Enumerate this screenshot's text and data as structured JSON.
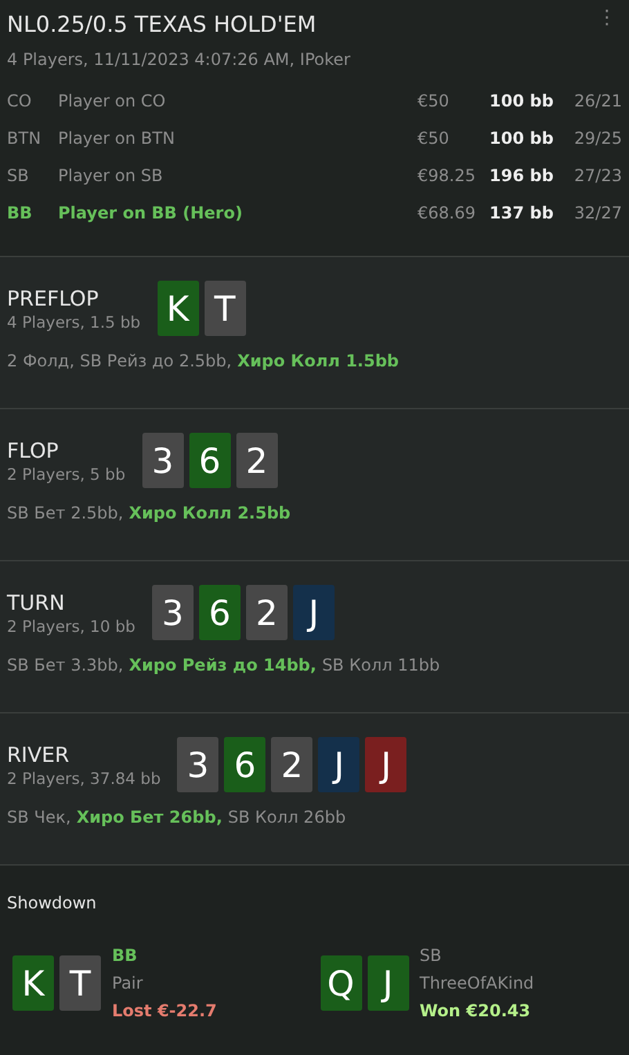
{
  "header": {
    "title": "NL0.25/0.5 TEXAS HOLD'EM",
    "subtitle": "4 Players, 11/11/2023 4:07:26 AM, IPoker",
    "menu_icon": "⋮"
  },
  "players": [
    {
      "position": "CO",
      "name": "Player on CO",
      "stack": "€50",
      "bb": "100 bb",
      "stats": "26/21",
      "hero": false
    },
    {
      "position": "BTN",
      "name": "Player on BTN",
      "stack": "€50",
      "bb": "100 bb",
      "stats": "29/25",
      "hero": false
    },
    {
      "position": "SB",
      "name": "Player on SB",
      "stack": "€98.25",
      "bb": "196 bb",
      "stats": "27/23",
      "hero": false
    },
    {
      "position": "BB",
      "name": "Player on BB (Hero)",
      "stack": "€68.69",
      "bb": "137 bb",
      "stats": "32/27",
      "hero": true
    }
  ],
  "streets": [
    {
      "name": "PREFLOP",
      "info": "4 Players, 1.5 bb",
      "cards": [
        {
          "rank": "K",
          "color": "#1a5e1a"
        },
        {
          "rank": "T",
          "color": "#484848"
        }
      ],
      "actions": [
        {
          "text": "2 Фолд, SB Рейз до 2.5bb,",
          "hero": false
        },
        {
          "text": "Хиро Колл 1.5bb",
          "hero": true
        }
      ]
    },
    {
      "name": "FLOP",
      "info": "2 Players, 5 bb",
      "cards": [
        {
          "rank": "3",
          "color": "#484848"
        },
        {
          "rank": "6",
          "color": "#1a5e1a"
        },
        {
          "rank": "2",
          "color": "#484848"
        }
      ],
      "actions": [
        {
          "text": "SB Бет 2.5bb,",
          "hero": false
        },
        {
          "text": "Хиро Колл 2.5bb",
          "hero": true
        }
      ]
    },
    {
      "name": "TURN",
      "info": "2 Players, 10 bb",
      "cards": [
        {
          "rank": "3",
          "color": "#484848"
        },
        {
          "rank": "6",
          "color": "#1a5e1a"
        },
        {
          "rank": "2",
          "color": "#484848"
        },
        {
          "rank": "J",
          "color": "#14304b"
        }
      ],
      "actions": [
        {
          "text": "SB Бет 3.3bb,",
          "hero": false
        },
        {
          "text": "Хиро Рейз до 14bb,",
          "hero": true
        },
        {
          "text": "SB Колл 11bb",
          "hero": false
        }
      ]
    },
    {
      "name": "RIVER",
      "info": "2 Players, 37.84 bb",
      "cards": [
        {
          "rank": "3",
          "color": "#484848"
        },
        {
          "rank": "6",
          "color": "#1a5e1a"
        },
        {
          "rank": "2",
          "color": "#484848"
        },
        {
          "rank": "J",
          "color": "#14304b"
        },
        {
          "rank": "J",
          "color": "#7a1f1f"
        }
      ],
      "actions": [
        {
          "text": "SB Чек,",
          "hero": false
        },
        {
          "text": "Хиро Бет 26bb,",
          "hero": true
        },
        {
          "text": "SB Колл 26bb",
          "hero": false
        }
      ]
    }
  ],
  "showdown": {
    "title": "Showdown",
    "hands": [
      {
        "position": "BB",
        "hero": true,
        "cards": [
          {
            "rank": "K",
            "color": "#1a5e1a"
          },
          {
            "rank": "T",
            "color": "#484848"
          }
        ],
        "hand": "Pair",
        "result": "Lost €-22.7",
        "kind": "lost"
      },
      {
        "position": "SB",
        "hero": false,
        "cards": [
          {
            "rank": "Q",
            "color": "#1a5e1a"
          },
          {
            "rank": "J",
            "color": "#1a5e1a"
          }
        ],
        "hand": "ThreeOfAKind",
        "result": "Won €20.43",
        "kind": "won"
      }
    ]
  }
}
